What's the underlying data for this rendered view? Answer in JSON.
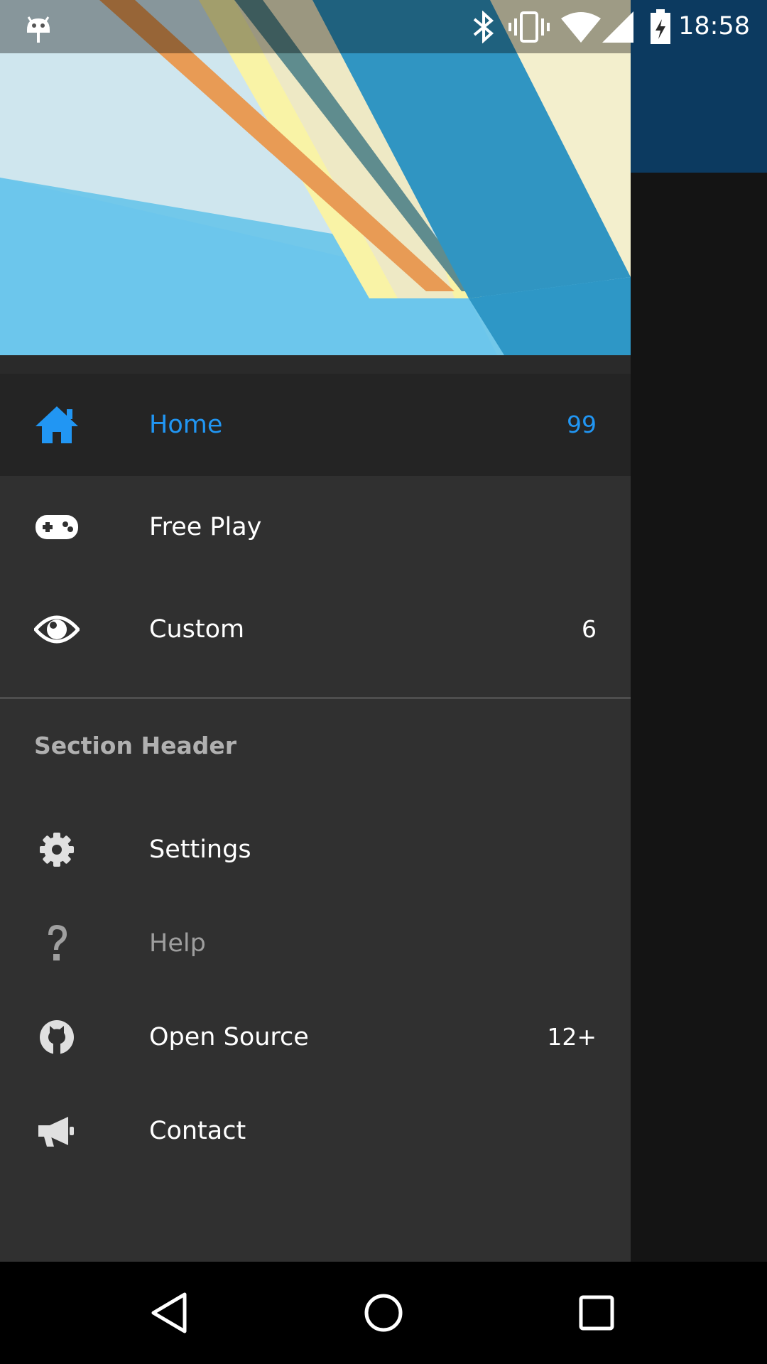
{
  "status_bar": {
    "time": "18:58",
    "icons": [
      "android-debug-icon",
      "bluetooth-icon",
      "vibrate-icon",
      "wifi-icon",
      "signal-icon",
      "battery-charging-icon"
    ]
  },
  "drawer": {
    "primary_items": [
      {
        "label": "Home",
        "badge": "99",
        "icon": "home-icon",
        "selected": true
      },
      {
        "label": "Free Play",
        "badge": "",
        "icon": "gamepad-icon",
        "selected": false
      },
      {
        "label": "Custom",
        "badge": "6",
        "icon": "eye-icon",
        "selected": false
      }
    ],
    "section_header": "Section Header",
    "secondary_items": [
      {
        "label": "Settings",
        "badge": "",
        "icon": "gear-icon",
        "enabled": true
      },
      {
        "label": "Help",
        "badge": "",
        "icon": "question-icon",
        "enabled": false
      },
      {
        "label": "Open Source",
        "badge": "12+",
        "icon": "github-icon",
        "enabled": true
      },
      {
        "label": "Contact",
        "badge": "",
        "icon": "bullhorn-icon",
        "enabled": true
      }
    ]
  },
  "nav_bar": {
    "buttons": [
      "back-icon",
      "home-circle-icon",
      "recents-icon"
    ]
  },
  "colors": {
    "accent": "#2196f3",
    "drawer_bg": "#303030",
    "selected_bg": "#242424",
    "toolbar": "#0c3a60"
  }
}
